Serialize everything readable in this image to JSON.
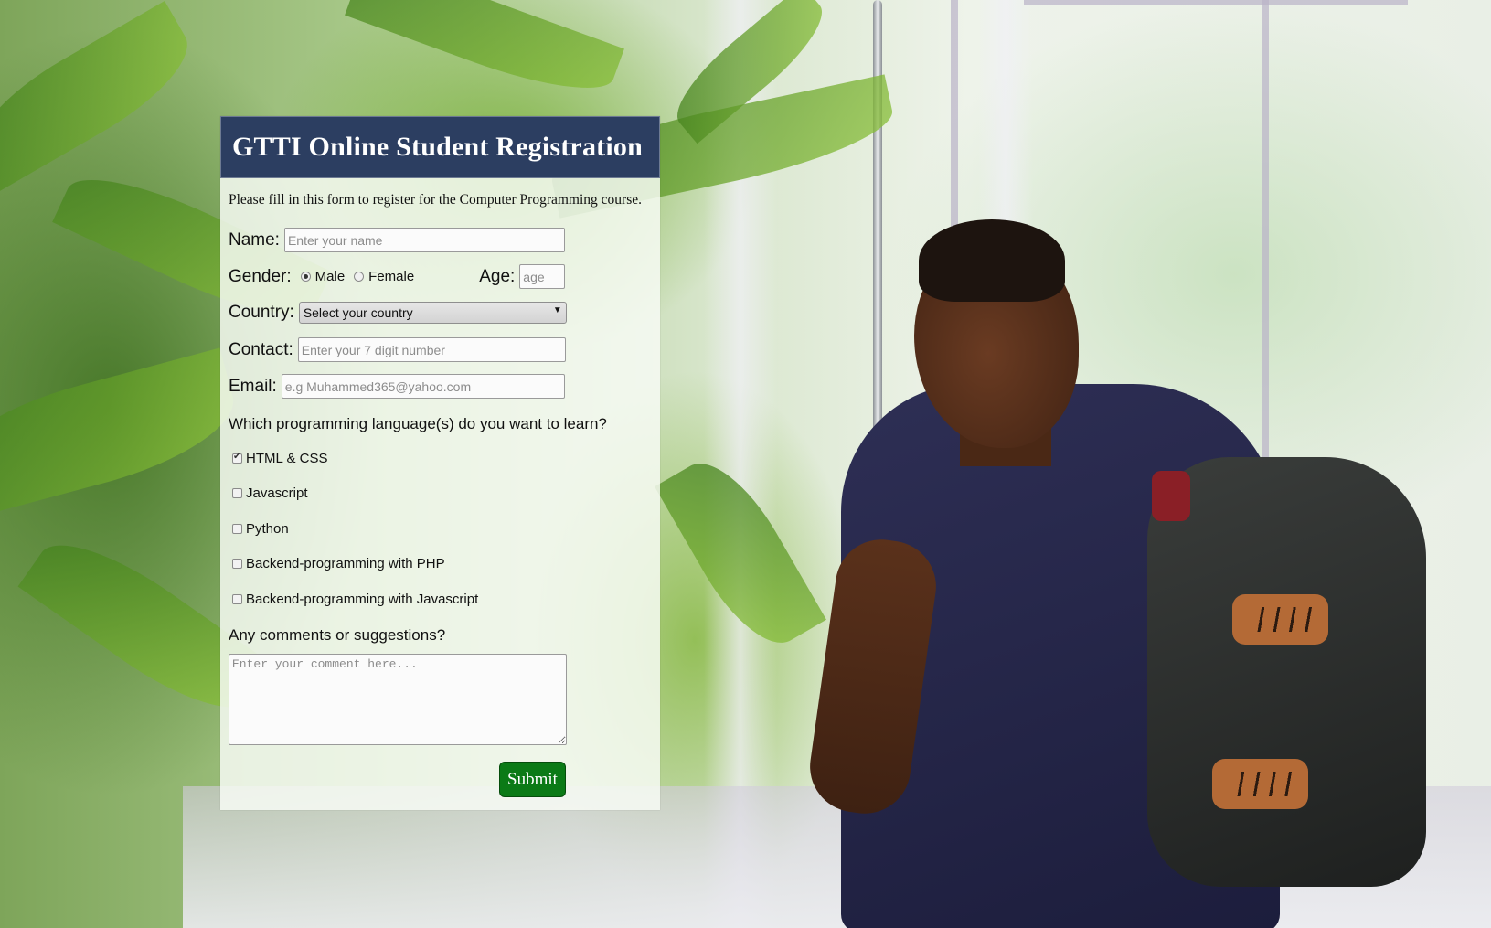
{
  "form": {
    "title": "GTTI Online Student Registration",
    "intro": "Please fill in this form to register for the Computer Programming course.",
    "name_label": "Name:",
    "name_placeholder": "Enter your name",
    "gender_label": "Gender:",
    "gender_options": [
      {
        "label": "Male",
        "selected": true
      },
      {
        "label": "Female",
        "selected": false
      }
    ],
    "age_label": "Age:",
    "age_placeholder": "age",
    "country_label": "Country:",
    "country_selected": "Select your country",
    "contact_label": "Contact:",
    "contact_placeholder": "Enter your 7 digit number",
    "email_label": "Email:",
    "email_placeholder": "e.g Muhammed365@yahoo.com",
    "languages_question": "Which programming language(s) do you want to learn?",
    "languages": [
      {
        "label": "HTML & CSS",
        "checked": true
      },
      {
        "label": "Javascript",
        "checked": false
      },
      {
        "label": "Python",
        "checked": false
      },
      {
        "label": "Backend-programming with PHP",
        "checked": false
      },
      {
        "label": "Backend-programming with Javascript",
        "checked": false
      }
    ],
    "comments_question": "Any comments or suggestions?",
    "comments_placeholder": "Enter your comment here...",
    "submit_label": "Submit"
  },
  "colors": {
    "header_bg": "#2c3e61",
    "submit_bg": "#0b7a16"
  },
  "background": {
    "icons": [
      "student-photo",
      "plant-leaves"
    ]
  }
}
